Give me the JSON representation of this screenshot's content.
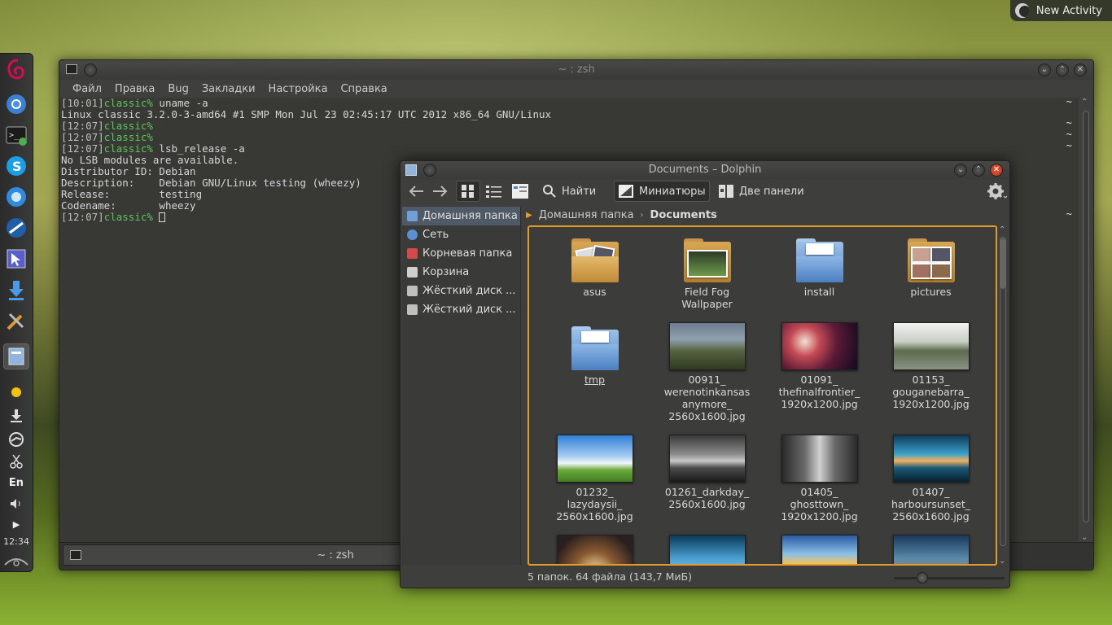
{
  "activity": {
    "new_label": "New Activity"
  },
  "panel": {
    "lang": "En",
    "clock": "12:34"
  },
  "konsole": {
    "title": "~ : zsh",
    "menu": [
      "Файл",
      "Правка",
      "Bug",
      "Закладки",
      "Настройка",
      "Справка"
    ],
    "lines": [
      {
        "time": "[10:01]",
        "user": "classic%",
        "cmd": " uname -a"
      },
      {
        "out": "Linux classic 3.2.0-3-amd64 #1 SMP Mon Jul 23 02:45:17 UTC 2012 x86_64 GNU/Linux"
      },
      {
        "time": "[12:07]",
        "user": "classic%",
        "cmd": ""
      },
      {
        "time": "[12:07]",
        "user": "classic%",
        "cmd": ""
      },
      {
        "time": "[12:07]",
        "user": "classic%",
        "cmd": " lsb_release -a"
      },
      {
        "out": "No LSB modules are available."
      },
      {
        "out": "Distributor ID:\tDebian"
      },
      {
        "out": "Description:\tDebian GNU/Linux testing (wheezy)"
      },
      {
        "out": "Release:\ttesting"
      },
      {
        "out": "Codename:\twheezy"
      },
      {
        "time": "[12:07]",
        "user": "classic%",
        "cmd": " "
      }
    ],
    "tilde": "~",
    "tab_label": "~ : zsh"
  },
  "dolphin": {
    "title": "Documents – Dolphin",
    "toolbar": {
      "find": "Найти",
      "preview": "Миниатюры",
      "split": "Две панели"
    },
    "places": [
      {
        "label": "Домашняя папка",
        "color": "#6f9fd8"
      },
      {
        "label": "Сеть",
        "color": "#5a8fd0"
      },
      {
        "label": "Корневая папка",
        "color": "#d24a4a"
      },
      {
        "label": "Корзина",
        "color": "#cfcfcf"
      },
      {
        "label": "Жёсткий диск ...",
        "color": "#bfbfbf"
      },
      {
        "label": "Жёсткий диск ...",
        "color": "#bfbfbf"
      }
    ],
    "breadcrumb": {
      "home": "Домашняя папка",
      "current": "Documents"
    },
    "items": [
      {
        "label": "asus",
        "kind": "folder"
      },
      {
        "label": "Field Fog\nWallpaper",
        "kind": "folder"
      },
      {
        "label": "install",
        "kind": "folder-blue"
      },
      {
        "label": "pictures",
        "kind": "folder"
      },
      {
        "label": "tmp",
        "kind": "folder-blue"
      },
      {
        "label": "00911_\nwerenotinkansas\nanymore_\n2560x1600.jpg",
        "kind": "image"
      },
      {
        "label": "01091_\nthefinalfrontier_\n1920x1200.jpg",
        "kind": "image"
      },
      {
        "label": "01153_\ngouganebarra_\n1920x1200.jpg",
        "kind": "image"
      },
      {
        "label": "01232_\nlazydaysii_\n2560x1600.jpg",
        "kind": "image"
      },
      {
        "label": "01261_darkday_\n2560x1600.jpg",
        "kind": "image"
      },
      {
        "label": "01405_\nghosttown_\n1920x1200.jpg",
        "kind": "image"
      },
      {
        "label": "01407_\nharboursunset_\n2560x1600.jpg",
        "kind": "image"
      }
    ],
    "status": "5 папок. 64 файла (143,7 МиБ)"
  }
}
